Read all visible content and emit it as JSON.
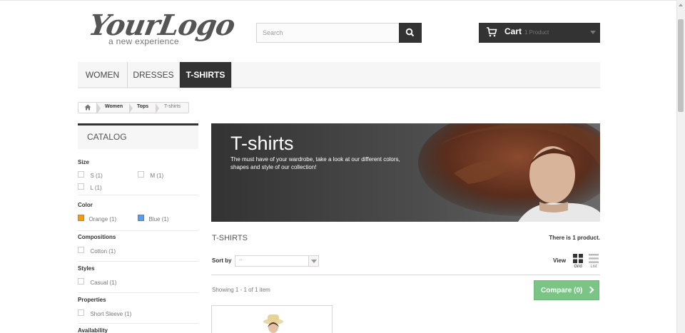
{
  "header": {
    "logo_text": "YourLogo",
    "logo_tagline": "a new experience",
    "search": {
      "placeholder": "Search"
    },
    "cart": {
      "label": "Cart",
      "count": "1 Product"
    }
  },
  "nav": {
    "items": [
      {
        "label": "WOMEN"
      },
      {
        "label": "DRESSES"
      },
      {
        "label": "T-SHIRTS"
      }
    ]
  },
  "breadcrumb": {
    "items": [
      "Women",
      "Tops",
      "T-shirts"
    ]
  },
  "sidebar": {
    "title": "CATALOG",
    "groups": {
      "size": {
        "title": "Size",
        "options": [
          "S (1)",
          "M (1)",
          "L (1)"
        ]
      },
      "color": {
        "title": "Color",
        "options": [
          {
            "label": "Orange (1)",
            "color": "#f39c11"
          },
          {
            "label": "Blue (1)",
            "color": "#5d9cec"
          }
        ]
      },
      "compositions": {
        "title": "Compositions",
        "options": [
          "Cotton (1)"
        ]
      },
      "styles": {
        "title": "Styles",
        "options": [
          "Casual (1)"
        ]
      },
      "properties": {
        "title": "Properties",
        "options": [
          "Short Sleeve (1)"
        ]
      },
      "availability": {
        "title": "Availability"
      }
    }
  },
  "banner": {
    "title": "T-shirts",
    "description": "The must have of your wardrobe, take a look at our different colors, shapes and style of our collection!"
  },
  "listing": {
    "title": "T-SHIRTS",
    "count_text": "There is 1 product.",
    "sort_label": "Sort by",
    "sort_value": "--",
    "view_label": "View",
    "grid_label": "Grid",
    "list_label": "List",
    "showing": "Showing 1 - 1 of 1 item",
    "compare_label": "Compare (0)"
  },
  "colors": {
    "dark": "#333333",
    "compare_green": "#7ac586"
  }
}
